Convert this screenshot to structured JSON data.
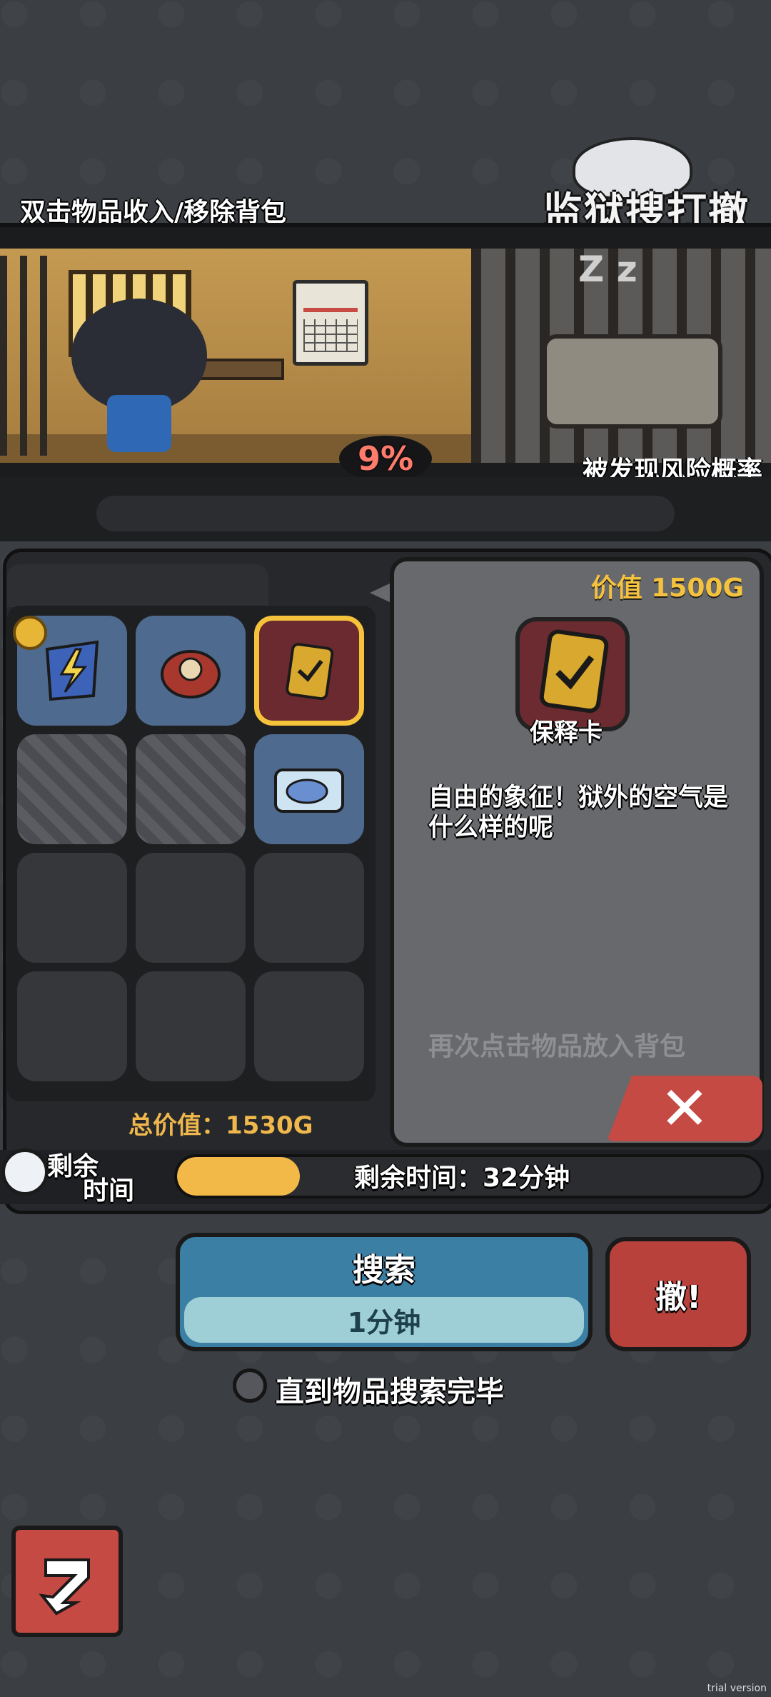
{
  "header": {
    "hint": "双击物品收入/移除背包",
    "logo": "监狱搜打撤"
  },
  "scene": {
    "risk_value": "9%",
    "risk_label": "被发现风险概率"
  },
  "inventory": {
    "total": "总价值：1530G",
    "slots": [
      {
        "item": "lightning-flag",
        "state": "filled"
      },
      {
        "item": "red-badge",
        "state": "filled"
      },
      {
        "item": "bail-card",
        "state": "selected"
      },
      {
        "item": null,
        "state": "locked"
      },
      {
        "item": null,
        "state": "locked"
      },
      {
        "item": "blue-box",
        "state": "filled"
      },
      {
        "item": null,
        "state": "empty"
      },
      {
        "item": null,
        "state": "empty"
      },
      {
        "item": null,
        "state": "empty"
      },
      {
        "item": null,
        "state": "empty"
      },
      {
        "item": null,
        "state": "empty"
      },
      {
        "item": null,
        "state": "empty"
      }
    ]
  },
  "detail": {
    "value": "价值 1500G",
    "name": "保释卡",
    "description": "自由的象征！狱外的空气是什么样的呢",
    "tap_hint": "再次点击物品放入背包"
  },
  "timer": {
    "label_top": "剩余",
    "label_bottom": "时间",
    "text": "剩余时间：32分钟",
    "progress": 0.21
  },
  "actions": {
    "search_label": "搜索",
    "search_duration": "1分钟",
    "withdraw_label": "撤!",
    "auto_label": "直到物品搜索完毕"
  },
  "colors": {
    "accent_gold": "#f5c23e",
    "search_blue": "#3c7fa5",
    "withdraw_red": "#b8413c",
    "risk_red": "#ff7b6b"
  },
  "watermark": "trial version"
}
